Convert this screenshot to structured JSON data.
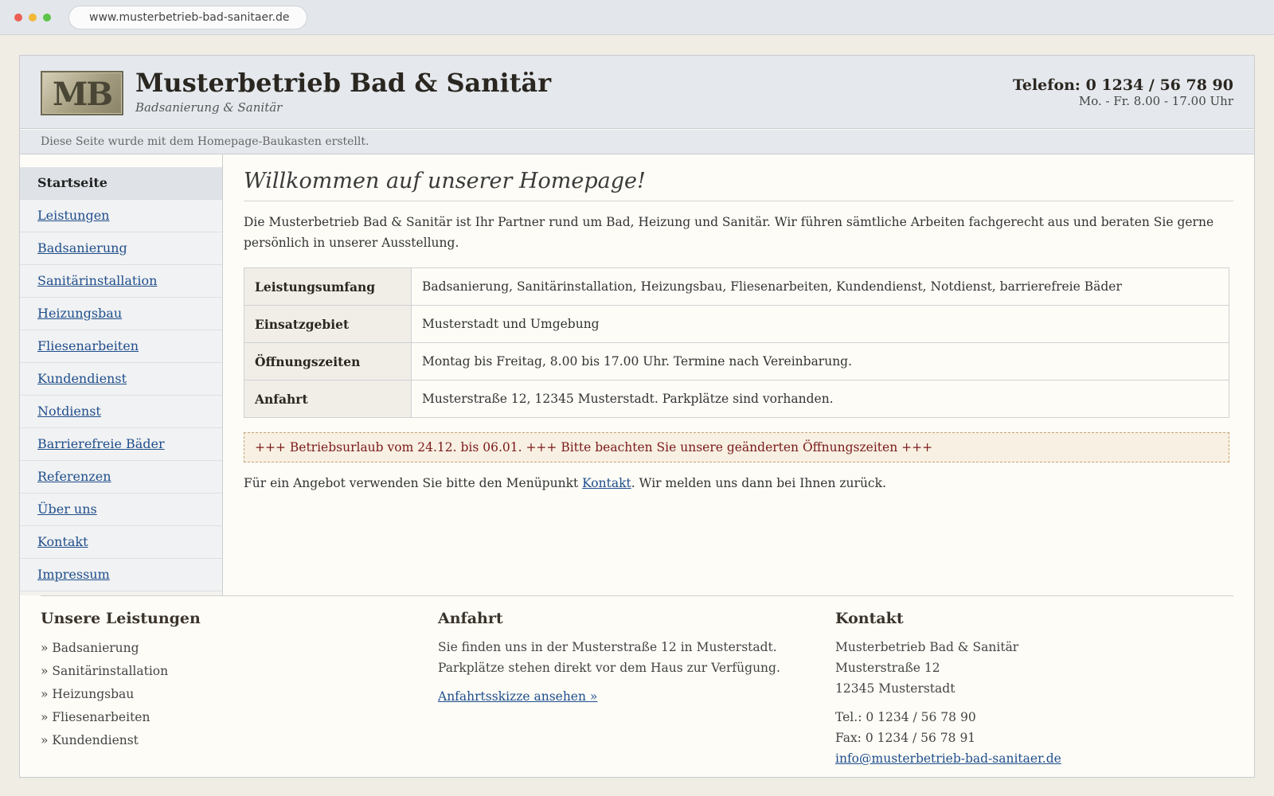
{
  "browser": {
    "url": "www.musterbetrieb-bad-sanitaer.de"
  },
  "header": {
    "logo_text": "MB",
    "title": "Musterbetrieb Bad & Sanitär",
    "subtitle": "Badsanierung & Sanitär",
    "phone": "Telefon: 0 1234 / 56 78 90",
    "hours": "Mo. - Fr. 8.00 - 17.00 Uhr"
  },
  "notice": "Diese Seite wurde mit dem Homepage-Baukasten erstellt.",
  "nav": [
    {
      "label": "Startseite"
    },
    {
      "label": "Leistungen"
    },
    {
      "label": "Badsanierung"
    },
    {
      "label": "Sanitärinstallation"
    },
    {
      "label": "Heizungsbau"
    },
    {
      "label": "Fliesenarbeiten"
    },
    {
      "label": "Kundendienst"
    },
    {
      "label": "Notdienst"
    },
    {
      "label": "Barrierefreie Bäder"
    },
    {
      "label": "Referenzen"
    },
    {
      "label": "Über uns"
    },
    {
      "label": "Kontakt"
    },
    {
      "label": "Impressum"
    }
  ],
  "main": {
    "heading": "Willkommen auf unserer Homepage!",
    "intro": "Die Musterbetrieb Bad & Sanitär ist Ihr Partner rund um Bad, Heizung und Sanitär. Wir führen sämtliche Arbeiten fachgerecht aus und beraten Sie gerne persönlich in unserer Ausstellung.",
    "table": [
      {
        "key": "Leistungsumfang",
        "value": "Badsanierung, Sanitärinstallation, Heizungsbau, Fliesenarbeiten, Kundendienst, Notdienst, barrierefreie Bäder"
      },
      {
        "key": "Einsatzgebiet",
        "value": "Musterstadt und Umgebung"
      },
      {
        "key": "Öffnungszeiten",
        "value": "Montag bis Freitag, 8.00 bis 17.00 Uhr. Termine nach Vereinbarung."
      },
      {
        "key": "Anfahrt",
        "value": "Musterstraße 12, 12345 Musterstadt. Parkplätze sind vorhanden."
      }
    ],
    "banner": "+++ Betriebsurlaub vom 24.12. bis 06.01. +++ Bitte beachten Sie unsere geänderten Öffnungszeiten +++",
    "cta_before": "Für ein Angebot verwenden Sie bitte den Menüpunkt ",
    "cta_link": "Kontakt",
    "cta_after": ". Wir melden uns dann bei Ihnen zurück."
  },
  "footer": {
    "services": {
      "title": "Unsere Leistungen",
      "items": [
        "» Badsanierung",
        "» Sanitärinstallation",
        "» Heizungsbau",
        "» Fliesenarbeiten",
        "» Kundendienst"
      ]
    },
    "directions": {
      "title": "Anfahrt",
      "text": "Sie finden uns in der Musterstraße 12 in Musterstadt. Parkplätze stehen direkt vor dem Haus zur Verfügung.",
      "link": "Anfahrtsskizze ansehen »"
    },
    "contact": {
      "title": "Kontakt",
      "name": "Musterbetrieb Bad & Sanitär",
      "street": "Musterstraße 12",
      "city": "12345 Musterstadt",
      "tel": "Tel.: 0 1234 / 56 78 90",
      "fax": "Fax: 0 1234 / 56 78 91",
      "email": "info@musterbetrieb-bad-sanitaer.de"
    }
  },
  "colors": {
    "link": "#1f4e8c",
    "banner_text": "#7a1a1a",
    "header_bg": "#e5e9ed"
  }
}
